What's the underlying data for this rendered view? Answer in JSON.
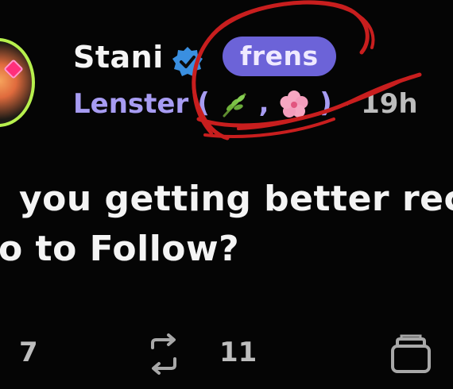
{
  "post": {
    "author": {
      "name": "Stani",
      "badge": "frens",
      "avatar_icon": "avatar-image",
      "verified_icon": "verified-badge-icon"
    },
    "meta": {
      "app": "Lenster",
      "open_paren": "(",
      "comma": ",",
      "close_paren": ")",
      "separator": "·",
      "time": "19h",
      "emoji": [
        "leaf-icon",
        "cherry-blossom-icon"
      ]
    },
    "content": {
      "line1": "you getting better reco",
      "line2": "o to Follow?"
    },
    "actions": {
      "comments_count": "7",
      "repost_count": "11",
      "repost_icon": "repost-icon",
      "collect_icon": "collect-icon"
    }
  },
  "colors": {
    "background": "#050505",
    "badge": "#6c63d8",
    "app_text": "#a79cf2",
    "scribble": "#c81e1e",
    "avatar_ring": "#b7f04d"
  }
}
